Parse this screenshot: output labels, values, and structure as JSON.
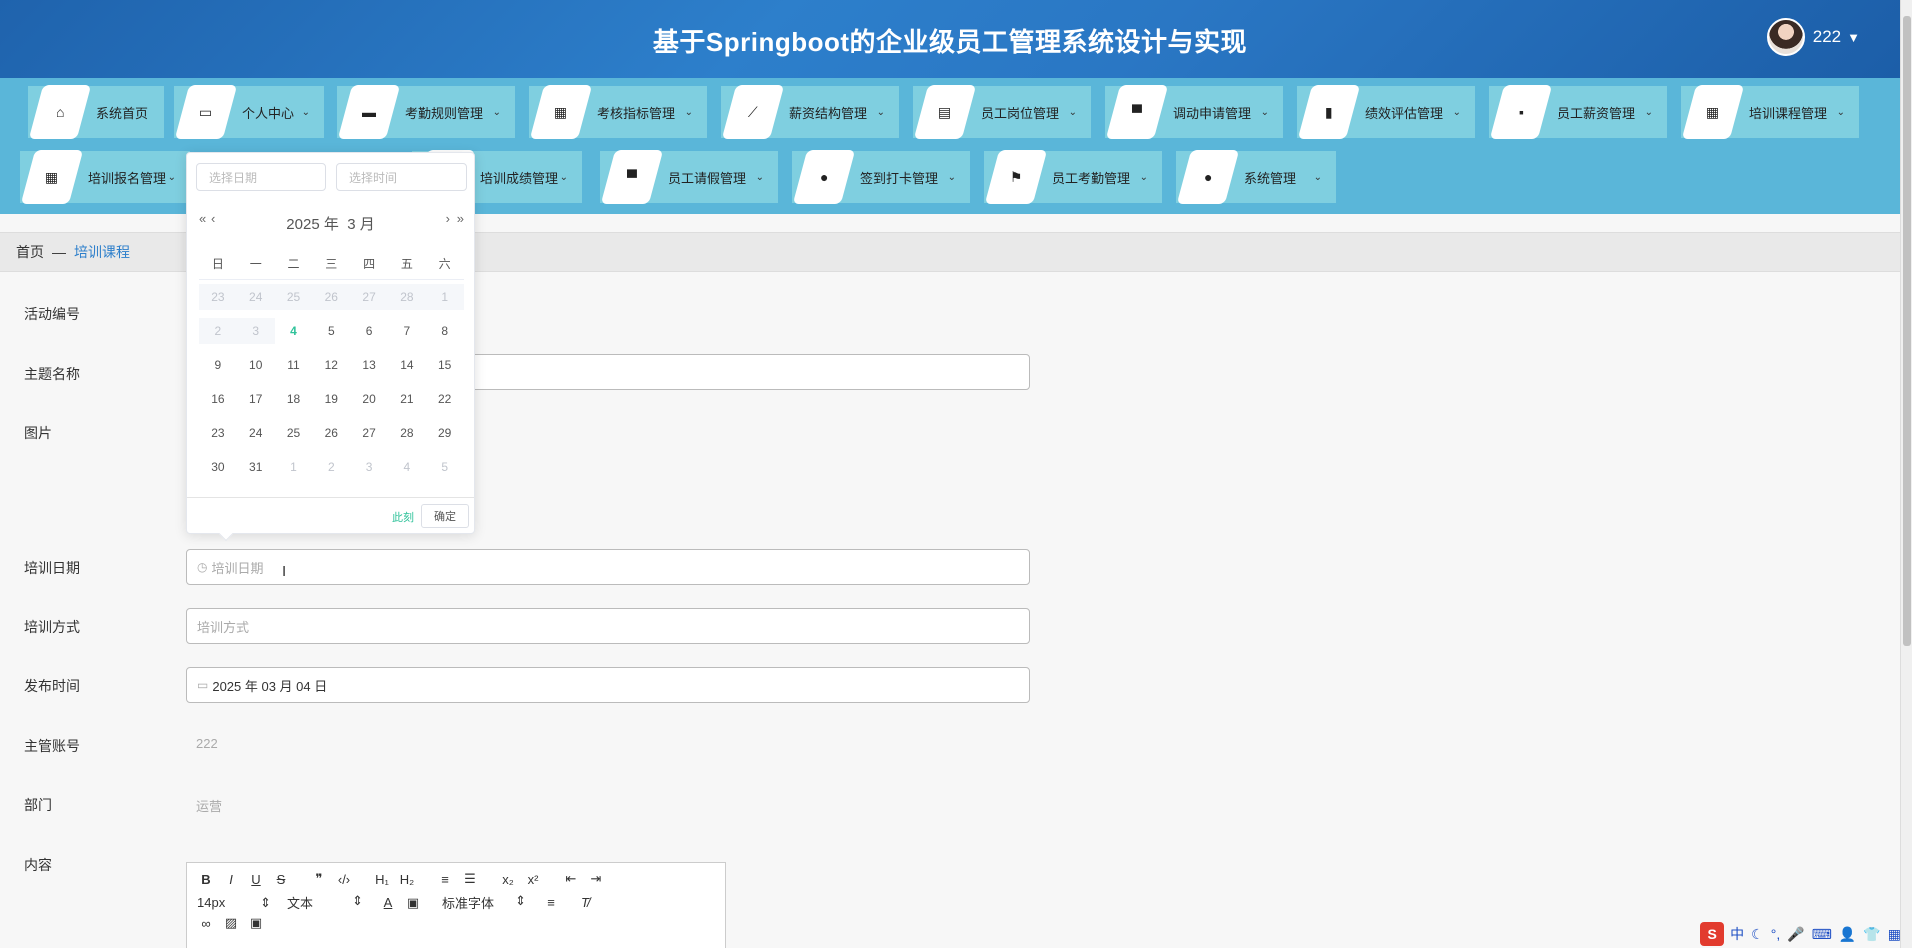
{
  "header": {
    "title": "基于Springboot的企业级员工管理系统设计与实现",
    "username": "222"
  },
  "nav": {
    "row1": [
      {
        "label": "系统首页",
        "icon": "home-icon",
        "glyph": "⌂",
        "dropdown": false
      },
      {
        "label": "个人中心",
        "icon": "id-card-icon",
        "glyph": "▭",
        "dropdown": true
      },
      {
        "label": "考勤规则管理",
        "icon": "briefcase-icon",
        "glyph": "▬",
        "dropdown": true
      },
      {
        "label": "考核指标管理",
        "icon": "grid-icon",
        "glyph": "▦",
        "dropdown": true
      },
      {
        "label": "薪资结构管理",
        "icon": "chart-line-icon",
        "glyph": "⟋",
        "dropdown": true
      },
      {
        "label": "员工岗位管理",
        "icon": "clipboard-icon",
        "glyph": "▤",
        "dropdown": true
      },
      {
        "label": "调动申请管理",
        "icon": "monitor-icon",
        "glyph": "▀",
        "dropdown": true
      },
      {
        "label": "绩效评估管理",
        "icon": "bar-chart-icon",
        "glyph": "▮",
        "dropdown": true
      },
      {
        "label": "员工薪资管理",
        "icon": "message-icon",
        "glyph": "▪",
        "dropdown": true
      },
      {
        "label": "培训课程管理",
        "icon": "grid-icon",
        "glyph": "▦",
        "dropdown": true
      }
    ],
    "row2": [
      {
        "label": "培训报名管理",
        "icon": "grid-icon",
        "glyph": "▦",
        "dropdown": true
      },
      {
        "label": "培训成绩管理",
        "icon": "document-icon",
        "glyph": "▤",
        "dropdown": true
      },
      {
        "label": "员工请假管理",
        "icon": "laptop-icon",
        "glyph": "▀",
        "dropdown": true
      },
      {
        "label": "签到打卡管理",
        "icon": "user-icon",
        "glyph": "●",
        "dropdown": true
      },
      {
        "label": "员工考勤管理",
        "icon": "flag-icon",
        "glyph": "⚑",
        "dropdown": true
      },
      {
        "label": "系统管理",
        "icon": "map-pin-icon",
        "glyph": "●",
        "dropdown": true
      }
    ]
  },
  "breadcrumb": {
    "home": "首页",
    "separator": "—",
    "current": "培训课程"
  },
  "form": {
    "activity_no": {
      "label": "活动编号"
    },
    "topic": {
      "label": "主题名称"
    },
    "image": {
      "label": "图片"
    },
    "training_date": {
      "label": "培训日期",
      "placeholder": "培训日期"
    },
    "training_mode": {
      "label": "培训方式",
      "placeholder": "培训方式"
    },
    "publish_time": {
      "label": "发布时间",
      "value": "2025 年 03 月 04 日"
    },
    "manager_account": {
      "label": "主管账号",
      "value": "222"
    },
    "department": {
      "label": "部门",
      "value": "运营"
    },
    "content": {
      "label": "内容"
    }
  },
  "picker": {
    "date_placeholder": "选择日期",
    "time_placeholder": "选择时间",
    "year": "2025 年",
    "month": "3 月",
    "weekdays": [
      "日",
      "一",
      "二",
      "三",
      "四",
      "五",
      "六"
    ],
    "weeks": [
      [
        {
          "d": "23",
          "t": "dis"
        },
        {
          "d": "24",
          "t": "dis"
        },
        {
          "d": "25",
          "t": "dis"
        },
        {
          "d": "26",
          "t": "dis"
        },
        {
          "d": "27",
          "t": "dis"
        },
        {
          "d": "28",
          "t": "dis"
        },
        {
          "d": "1",
          "t": "dis"
        }
      ],
      [
        {
          "d": "2",
          "t": "dis"
        },
        {
          "d": "3",
          "t": "dis"
        },
        {
          "d": "4",
          "t": "today"
        },
        {
          "d": "5",
          "t": ""
        },
        {
          "d": "6",
          "t": ""
        },
        {
          "d": "7",
          "t": ""
        },
        {
          "d": "8",
          "t": ""
        }
      ],
      [
        {
          "d": "9",
          "t": ""
        },
        {
          "d": "10",
          "t": ""
        },
        {
          "d": "11",
          "t": ""
        },
        {
          "d": "12",
          "t": ""
        },
        {
          "d": "13",
          "t": ""
        },
        {
          "d": "14",
          "t": ""
        },
        {
          "d": "15",
          "t": ""
        }
      ],
      [
        {
          "d": "16",
          "t": ""
        },
        {
          "d": "17",
          "t": ""
        },
        {
          "d": "18",
          "t": ""
        },
        {
          "d": "19",
          "t": ""
        },
        {
          "d": "20",
          "t": ""
        },
        {
          "d": "21",
          "t": ""
        },
        {
          "d": "22",
          "t": ""
        }
      ],
      [
        {
          "d": "23",
          "t": ""
        },
        {
          "d": "24",
          "t": ""
        },
        {
          "d": "25",
          "t": ""
        },
        {
          "d": "26",
          "t": ""
        },
        {
          "d": "27",
          "t": ""
        },
        {
          "d": "28",
          "t": ""
        },
        {
          "d": "29",
          "t": ""
        }
      ],
      [
        {
          "d": "30",
          "t": ""
        },
        {
          "d": "31",
          "t": ""
        },
        {
          "d": "1",
          "t": "o"
        },
        {
          "d": "2",
          "t": "o"
        },
        {
          "d": "3",
          "t": "o"
        },
        {
          "d": "4",
          "t": "o"
        },
        {
          "d": "5",
          "t": "o"
        }
      ]
    ],
    "now_label": "此刻",
    "confirm_label": "确定"
  },
  "editor": {
    "font_size": "14px",
    "block_type": "文本",
    "font_family": "标准字体"
  },
  "ime": {
    "items": [
      "中",
      "☾",
      "°,",
      "🎤",
      "⌨",
      "👤",
      "👕",
      "▦"
    ]
  },
  "colors": {
    "header_bg": "#2a77c4",
    "nav_bg": "#5ab6d9",
    "nav_item_bg": "#7fcfe0",
    "accent_green": "#2fc29a",
    "breadcrumb_link": "#2d7fcb"
  }
}
